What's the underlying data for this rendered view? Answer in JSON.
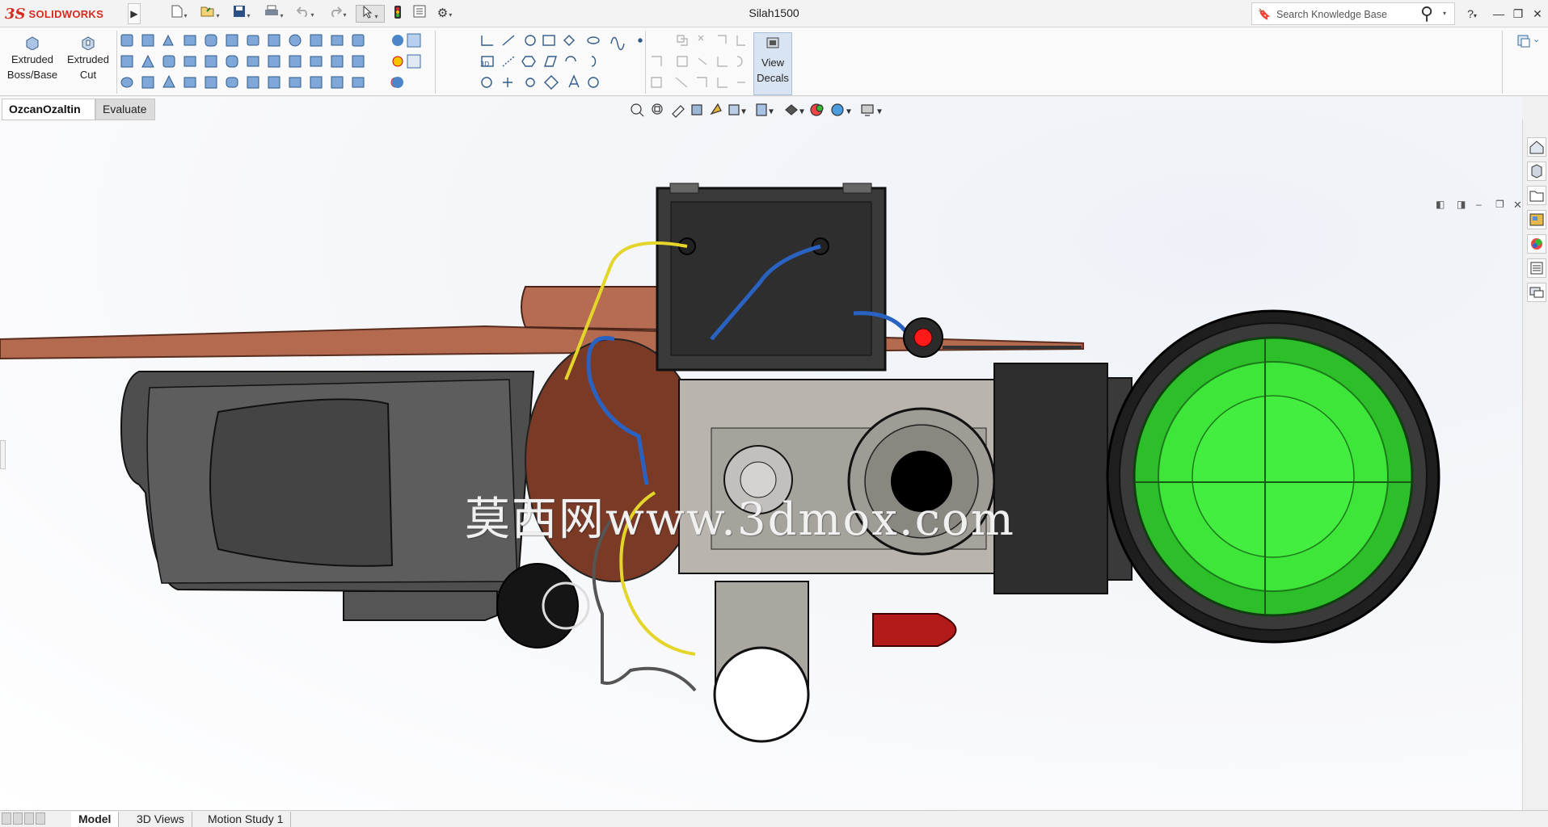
{
  "app": {
    "brand_prefix": "3S",
    "brand_name": "SOLIDWORKS",
    "document_title": "Silah1500"
  },
  "search": {
    "placeholder": "Search Knowledge Base"
  },
  "window_controls": {
    "help": "?",
    "minimize": "—",
    "restore": "❐",
    "close": "✕"
  },
  "command_manager": {
    "extruded_boss": "Extruded\nBoss/Base",
    "extruded_cut": "Extruded\nCut",
    "view_decals": "View\nDecals"
  },
  "tabs": [
    {
      "label": "OzcanOzaltin",
      "active": true
    },
    {
      "label": "Evaluate",
      "active": false
    }
  ],
  "bottom_tabs": [
    {
      "label": "Model",
      "active": true
    },
    {
      "label": "3D Views",
      "active": false
    },
    {
      "label": "Motion Study 1",
      "active": false
    }
  ],
  "watermark": "莫西网www.3dmox.com",
  "colors": {
    "brand_red": "#d52b1e",
    "scope_green": "#3ee63a",
    "copper": "#b0684e",
    "body_dark": "#4a4a4a"
  },
  "icons": {
    "task_pane": [
      "home-icon",
      "parts-icon",
      "folder-icon",
      "view-palette-icon",
      "appearances-icon",
      "custom-properties-icon",
      "forum-icon"
    ],
    "heads_up": [
      "zoom-to-fit-icon",
      "zoom-area-icon",
      "previous-view-icon",
      "section-view-icon",
      "dynamic-annotation-icon",
      "view-orientation-icon",
      "display-style-icon",
      "hide-show-icon",
      "edit-appearance-icon",
      "apply-scene-icon",
      "view-settings-icon"
    ]
  }
}
